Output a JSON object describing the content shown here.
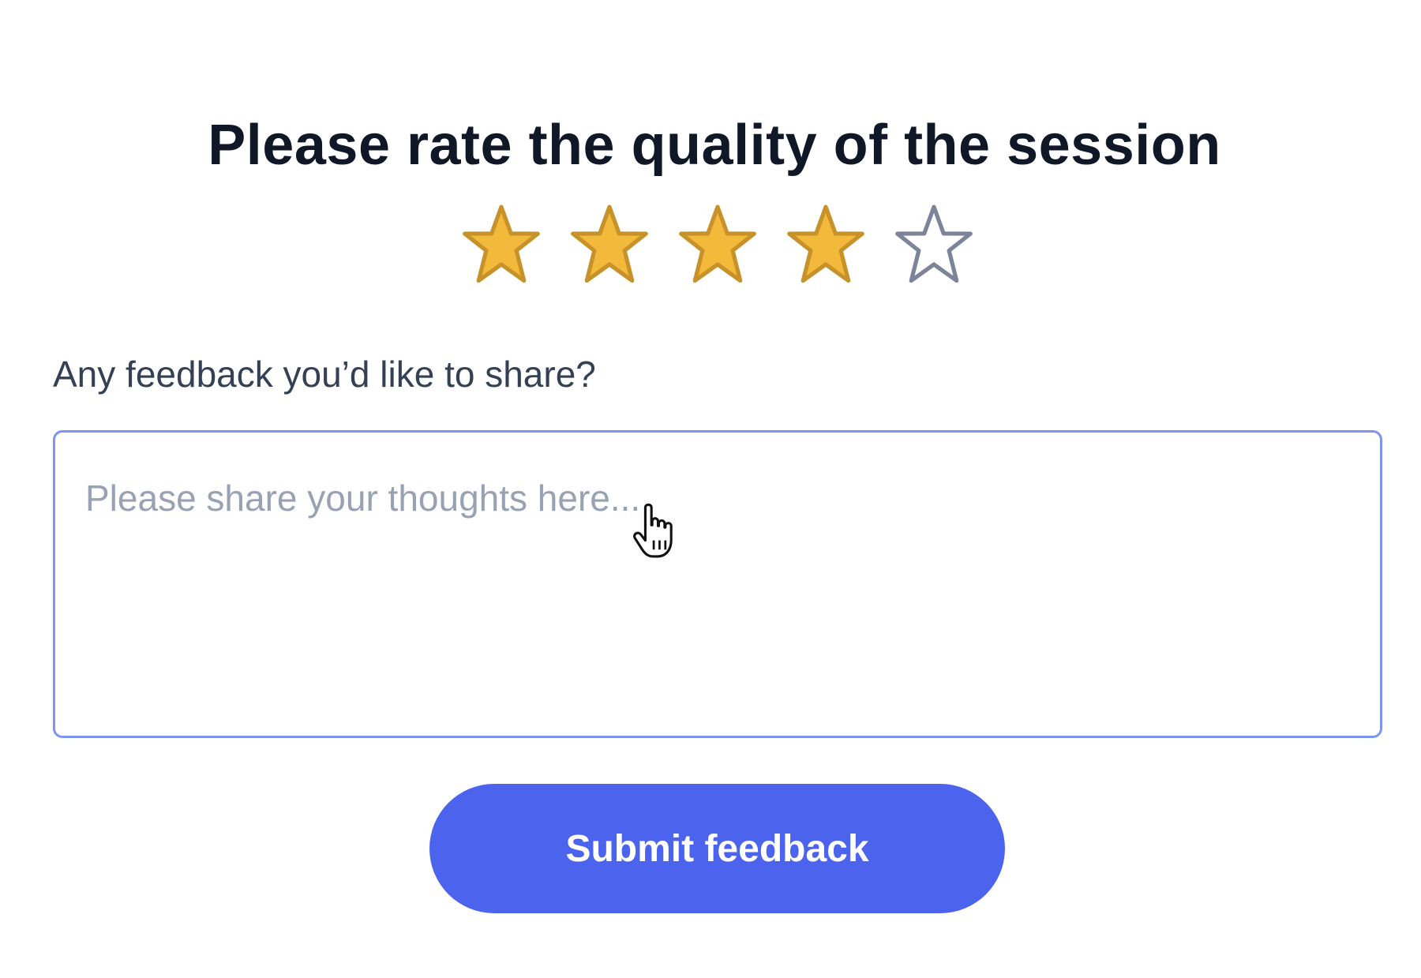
{
  "title": "Please rate the quality of the session",
  "rating": {
    "value": 4,
    "max": 5,
    "filled_color": "#F2B93B",
    "filled_stroke": "#C8922A",
    "empty_color": "#FFFFFF",
    "empty_stroke": "#7B8499"
  },
  "feedback": {
    "label": "Any feedback you’d like to share?",
    "placeholder": "Please share your thoughts here...",
    "value": ""
  },
  "submit_label": "Submit feedback",
  "colors": {
    "accent": "#4C63EE",
    "textarea_border": "#8093F1"
  },
  "icons": {
    "star": "star-icon",
    "cursor": "hand-pointer-icon"
  }
}
